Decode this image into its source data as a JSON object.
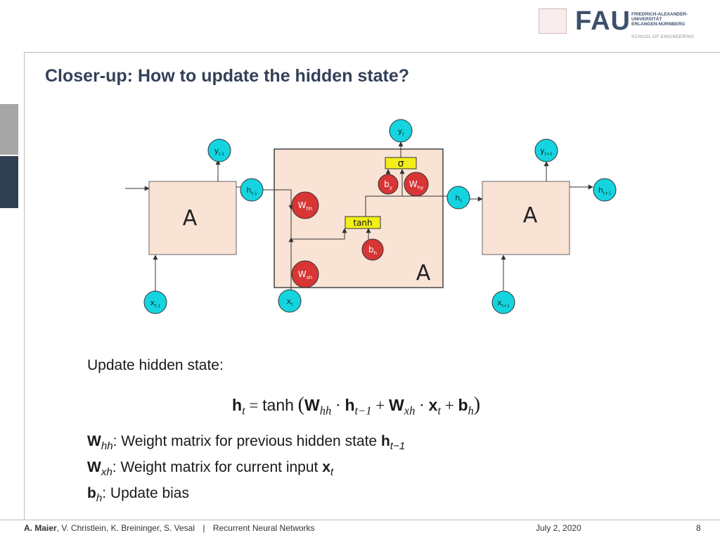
{
  "header": {
    "logo_text": "FAU",
    "university_lines": [
      "FRIEDRICH-ALEXANDER-",
      "UNIVERSITÄT",
      "ERLANGEN-NÜRNBERG"
    ],
    "school": "SCHOOL OF ENGINEERING"
  },
  "slide": {
    "title": "Closer-up: How to update the hidden state?"
  },
  "diagram": {
    "left_cell": "A",
    "center_cell": "A",
    "right_cell": "A",
    "nodes": {
      "y_prev": "y",
      "y_prev_sub": "t-1",
      "y_cur": "y",
      "y_cur_sub": "t",
      "y_next": "y",
      "y_next_sub": "t+1",
      "h_prev": "h",
      "h_prev_sub": "t-1",
      "h_cur": "h",
      "h_cur_sub": "t",
      "h_next": "h",
      "h_next_sub": "t+1",
      "x_prev": "x",
      "x_prev_sub": "t-1",
      "x_cur": "x",
      "x_cur_sub": "t",
      "x_next": "x",
      "x_next_sub": "t+1",
      "w_hh": "W",
      "w_hh_sub": "hh",
      "w_xh": "W",
      "w_xh_sub": "xh",
      "w_hy": "W",
      "w_hy_sub": "hy",
      "b_y": "b",
      "b_y_sub": "y",
      "b_h": "b",
      "b_h_sub": "h"
    },
    "tanh_label": "tanh",
    "sigma_label": "σ",
    "colors": {
      "cell_fill": "#f9e3d5",
      "node_cyan": "#14d4df",
      "node_red": "#d83535",
      "gate_yellow": "#f2ee1a"
    }
  },
  "content": {
    "intro": "Update hidden state:",
    "formula": {
      "lhs": "h",
      "lhs_sub": "t",
      "eq": "=",
      "fn": "tanh",
      "open": "(",
      "w1": "W",
      "w1_sub": "hh",
      "dot1": "·",
      "h": "h",
      "h_sub": "t−1",
      "plus1": "+",
      "w2": "W",
      "w2_sub": "xh",
      "dot2": "·",
      "x": "x",
      "x_sub": "t",
      "plus2": "+",
      "b": "b",
      "b_sub": "h",
      "close": ")"
    },
    "defs": [
      {
        "sym": "W",
        "sub": "hh",
        "text": ": Weight matrix for previous hidden state ",
        "ref": "h",
        "ref_sub": "t−1"
      },
      {
        "sym": "W",
        "sub": "xh",
        "text": ": Weight matrix for current input ",
        "ref": "x",
        "ref_sub": "t"
      },
      {
        "sym": "b",
        "sub": "h",
        "text": ": Update bias",
        "ref": "",
        "ref_sub": ""
      }
    ]
  },
  "footer": {
    "lead_author": "A. Maier",
    "coauthors": ", V. Christlein, K. Breininger, S. Vesal",
    "separator": "|",
    "course": "Recurrent Neural Networks",
    "date": "July 2, 2020",
    "page": "8"
  }
}
